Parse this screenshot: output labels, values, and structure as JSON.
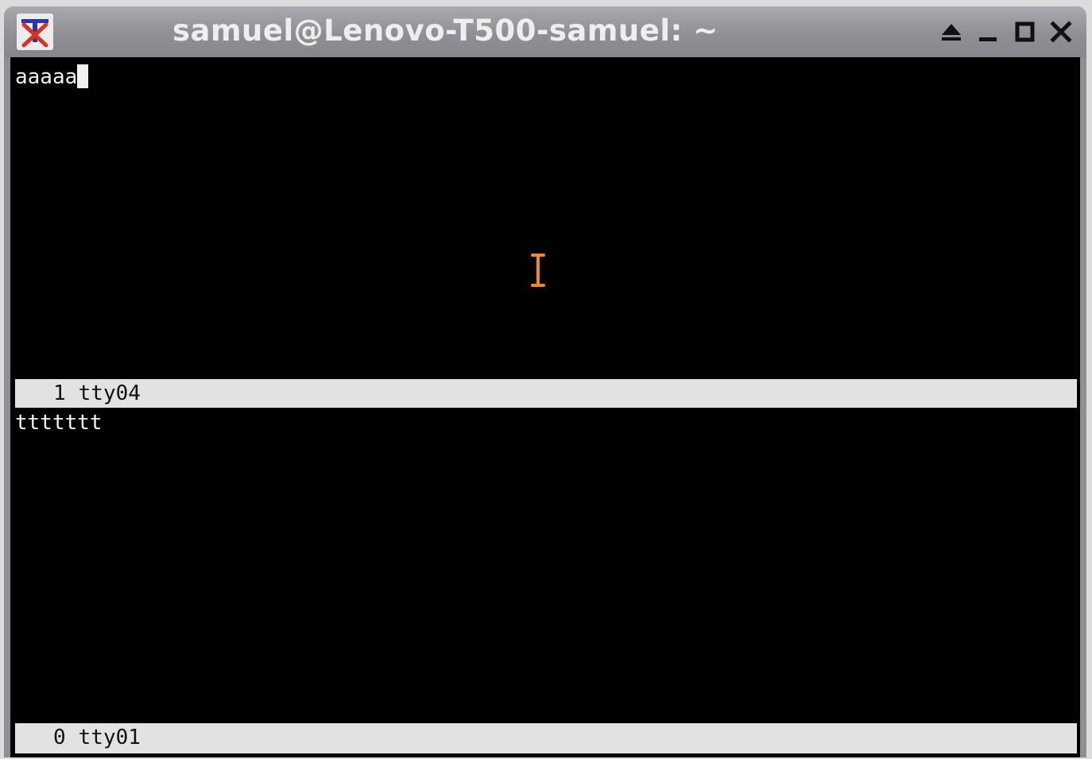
{
  "window": {
    "title": "samuel@Lenovo-T500-samuel: ~",
    "controls": [
      "shade-icon",
      "minimize-icon",
      "maximize-icon",
      "close-icon"
    ]
  },
  "panes": {
    "top": {
      "text": "aaaaa",
      "status_number": "1",
      "status_name": "tty04"
    },
    "bottom": {
      "text": "ttttttt",
      "status_number": "0",
      "status_name": "tty01"
    }
  },
  "colors": {
    "terminal_background": "#000000",
    "terminal_text": "#f0f0f0",
    "statusbar_background": "#e2e2e2",
    "mouse_cursor": "#f08a1c",
    "titlebar": "#999999"
  }
}
